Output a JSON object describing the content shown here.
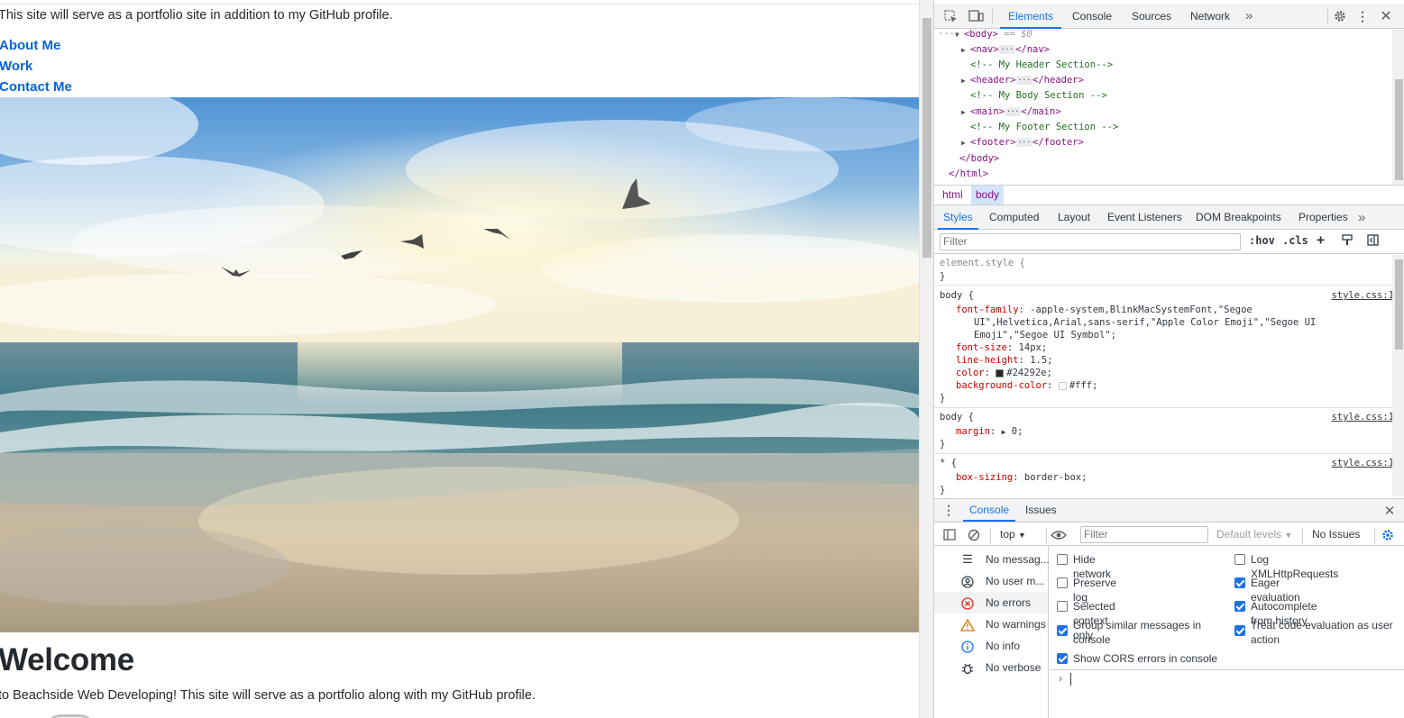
{
  "page": {
    "intro_text": "This site will serve as a portfolio site in addition to my GitHub profile.",
    "nav_links": [
      "About Me",
      "Work",
      "Contact Me"
    ],
    "welcome_heading": "Welcome",
    "welcome_text": "to Beachside Web Developing! This site will serve as a portfolio along with my GitHub profile."
  },
  "devtools": {
    "main_tabs": [
      "Elements",
      "Console",
      "Sources",
      "Network"
    ],
    "active_main_tab": "Elements",
    "more_tabs": "»",
    "dom": {
      "body_open": "<body>",
      "body_marker": "== $0",
      "children": [
        {
          "kind": "tag",
          "open": "<nav>",
          "close": "</nav>"
        },
        {
          "kind": "comment",
          "text": "<!-- My Header Section-->"
        },
        {
          "kind": "tag",
          "open": "<header>",
          "close": "</header>"
        },
        {
          "kind": "comment",
          "text": "<!-- My Body Section -->"
        },
        {
          "kind": "tag",
          "open": "<main>",
          "close": "</main>"
        },
        {
          "kind": "comment",
          "text": "<!-- My Footer Section -->"
        },
        {
          "kind": "tag",
          "open": "<footer>",
          "close": "</footer>"
        }
      ],
      "body_close": "</body>",
      "html_close": "</html>"
    },
    "breadcrumbs": [
      "html",
      "body"
    ],
    "styles_tabs": [
      "Styles",
      "Computed",
      "Layout",
      "Event Listeners",
      "DOM Breakpoints",
      "Properties"
    ],
    "filter_placeholder": "Filter",
    "filter_tools": {
      "hov": ":hov",
      "cls": ".cls"
    },
    "rules": {
      "element_style": "element.style {",
      "close": "}",
      "body1_selector": "body {",
      "body1_source": "style.css:1",
      "font_family_prop": "font-family",
      "font_family_val1": "-apple-system,BlinkMacSystemFont,\"Segoe",
      "font_family_val2": "UI\",Helvetica,Arial,sans-serif,\"Apple Color Emoji\",\"Segoe UI",
      "font_family_val3": "Emoji\",\"Segoe UI Symbol\";",
      "font_size_prop": "font-size",
      "font_size_val": "14px;",
      "line_height_prop": "line-height",
      "line_height_val": "1.5;",
      "color_prop": "color",
      "color_val": "#24292e;",
      "bg_prop": "background-color",
      "bg_val": "#fff;",
      "body2_selector": "body {",
      "body2_source": "style.css:1",
      "margin_prop": "margin",
      "margin_val": "0;",
      "star_selector": "* {",
      "star_source": "style.css:1",
      "box_sizing_prop": "box-sizing",
      "box_sizing_val": "border-box;"
    },
    "drawer_tabs": [
      "Console",
      "Issues"
    ],
    "console": {
      "context": "top",
      "filter_placeholder": "Filter",
      "levels": "Default levels",
      "issues": "No Issues",
      "sidebar": [
        {
          "icon": "list-icon",
          "label": "No messag..."
        },
        {
          "icon": "user-icon",
          "label": "No user m..."
        },
        {
          "icon": "error-icon",
          "label": "No errors"
        },
        {
          "icon": "warning-icon",
          "label": "No warnings"
        },
        {
          "icon": "info-icon",
          "label": "No info"
        },
        {
          "icon": "bug-icon",
          "label": "No verbose"
        }
      ],
      "settings": [
        {
          "label": "Hide network",
          "checked": false
        },
        {
          "label": "Log XMLHttpRequests",
          "checked": false
        },
        {
          "label": "Preserve log",
          "checked": false
        },
        {
          "label": "Eager evaluation",
          "checked": true
        },
        {
          "label": "Selected context only",
          "checked": false
        },
        {
          "label": "Autocomplete from history",
          "checked": true
        },
        {
          "label": "Group similar messages in console",
          "checked": true
        },
        {
          "label": "Treat code evaluation as user action",
          "checked": true
        },
        {
          "label": "Show CORS errors in console",
          "checked": true
        }
      ],
      "prompt": "›"
    },
    "colors": {
      "accent": "#1a73e8",
      "tag": "#881280",
      "comment": "#236e25",
      "property": "#c80000",
      "swatch_dark": "#24292e",
      "swatch_light": "#ffffff"
    }
  }
}
